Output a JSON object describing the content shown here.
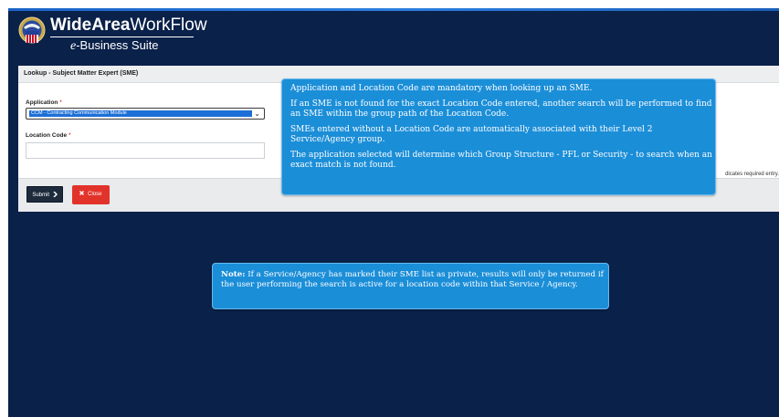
{
  "header": {
    "brand_bold": "WideArea",
    "brand_light": "WorkFlow",
    "brand_sub_prefix": "e",
    "brand_sub_rest": "-Business Suite"
  },
  "panel": {
    "title": "Lookup - Subject Matter Expert (SME)",
    "application_label": "Application",
    "application_value": "CCM - Contracting Communication Module",
    "location_label": "Location Code",
    "required_marker": "*",
    "required_note": "dicates required entry."
  },
  "buttons": {
    "submit": "Submit",
    "close": "Close"
  },
  "callout_main": {
    "p1": "Application and Location Code are mandatory when looking up an SME.",
    "p2": "If an SME is not found for the exact Location Code entered, another search will be performed to find an SME within the group path of the Location Code.",
    "p3": "SMEs entered without a Location Code are automatically associated with their Level 2 Service/Agency group.",
    "p4": "The application selected will determine which Group Structure - PFL or Security - to search when an exact match is not found."
  },
  "callout_note": {
    "label": "Note:",
    "text": "If a Service/Agency has marked their SME list as private, results will only be returned if the user performing the search is active for a location code within that Service / Agency."
  },
  "colors": {
    "background": "#0a2149",
    "callout": "#1b8ed8",
    "close_button": "#e2332b",
    "submit_button": "#1d2b3d",
    "selected_option": "#1c6fd6"
  },
  "icons": {
    "logo": "dod-seal-logo",
    "submit": "chevron-right-icon",
    "close": "x-icon",
    "select": "chevron-down-icon"
  }
}
